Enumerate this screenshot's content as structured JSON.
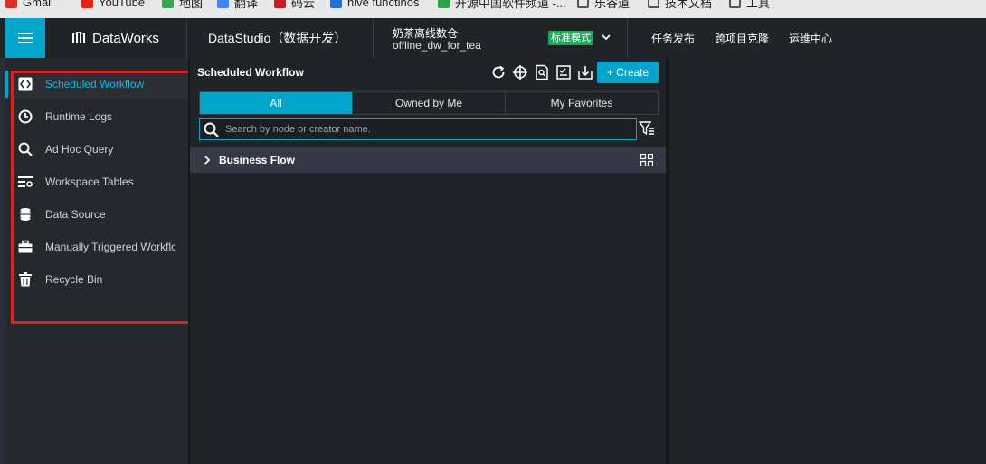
{
  "bookmarks": [
    {
      "label": "Gmail",
      "icon": "gmail-icon",
      "color": "#d93025"
    },
    {
      "label": "YouTube",
      "icon": "youtube-icon",
      "color": "#e62117"
    },
    {
      "label": "地图",
      "icon": "maps-icon",
      "color": "#34a853"
    },
    {
      "label": "翻译",
      "icon": "translate-icon",
      "color": "#4285f4"
    },
    {
      "label": "码云",
      "icon": "gitee-icon",
      "color": "#c71d23"
    },
    {
      "label": "hive functinos",
      "icon": "hive-icon",
      "color": "#1e6fd9"
    },
    {
      "label": "开源中国软件频道 -...",
      "icon": "oschina-icon",
      "color": "#2ca24b"
    },
    {
      "label": "乐谷道",
      "icon": "folder-icon",
      "color": "#555555"
    },
    {
      "label": "技术文档",
      "icon": "folder-icon",
      "color": "#555555"
    },
    {
      "label": "工具",
      "icon": "folder-icon",
      "color": "#555555"
    }
  ],
  "header": {
    "brand": "DataWorks",
    "studio": "DataStudio（数据开发）",
    "project_name": "奶茶离线数仓",
    "project_id": "offline_dw_for_tea",
    "mode": "标准模式",
    "links": [
      "任务发布",
      "跨项目克隆",
      "运维中心"
    ]
  },
  "sidebar": {
    "items": [
      {
        "label": "Scheduled Workflow",
        "icon": "code-icon",
        "active": true
      },
      {
        "label": "Runtime Logs",
        "icon": "clock-icon",
        "active": false
      },
      {
        "label": "Ad Hoc Query",
        "icon": "search-icon",
        "active": false
      },
      {
        "label": "Workspace Tables",
        "icon": "table-list-icon",
        "active": false
      },
      {
        "label": "Data Source",
        "icon": "database-icon",
        "active": false
      },
      {
        "label": "Manually Triggered Workflow",
        "icon": "briefcase-icon",
        "active": false
      },
      {
        "label": "Recycle Bin",
        "icon": "trash-icon",
        "active": false
      }
    ]
  },
  "panel": {
    "title": "Scheduled Workflow",
    "create_label": "+ Create",
    "tabs": [
      "All",
      "Owned by Me",
      "My Favorites"
    ],
    "search_placeholder": "Search by node or creator name.",
    "business_flow": "Business Flow"
  },
  "colors": {
    "accent": "#00a5cc",
    "badge": "#1ea858",
    "highlight": "#e02020"
  }
}
